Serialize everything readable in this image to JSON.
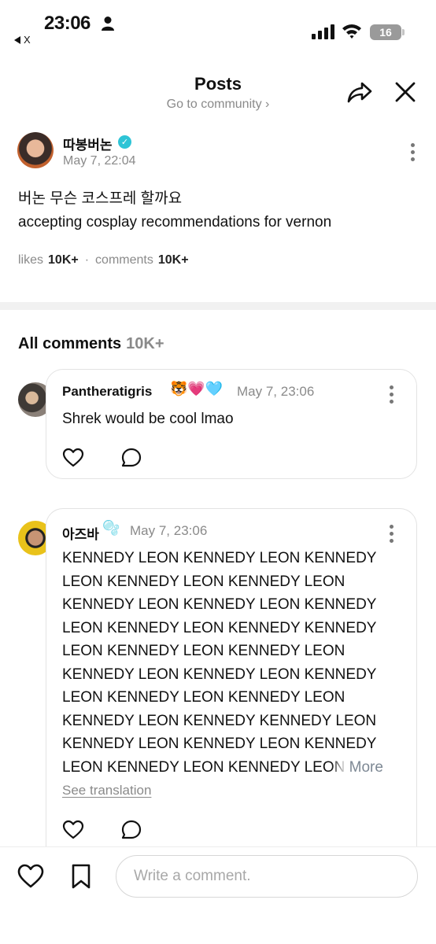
{
  "status_bar": {
    "time": "23:06",
    "back_app": "X",
    "battery": "16"
  },
  "header": {
    "title": "Posts",
    "subtitle": "Go to community ›"
  },
  "post": {
    "author": "따봉버논",
    "date": "May 7, 22:04",
    "text_line1": "버논 무슨 코스프레 할까요",
    "text_line2": "accepting cosplay recommendations for vernon",
    "likes_label": "likes",
    "likes_count": "10K+",
    "separator": "·",
    "comments_label": "comments",
    "comments_count": "10K+"
  },
  "comments_section": {
    "title": "All comments",
    "count": "10K+"
  },
  "comments": [
    {
      "author": "Pantheratigris",
      "emoji": "🐯💗🩵",
      "date": "May 7, 23:06",
      "text": "Shrek would be cool lmao"
    },
    {
      "author": "아즈바",
      "emoji": "🫧",
      "date": "May 7, 23:06",
      "lines": [
        "KENNEDY LEON KENNEDY LEON KENNEDY",
        "LEON KENNEDY LEON KENNEDY LEON",
        "KENNEDY LEON KENNEDY LEON KENNEDY",
        "LEON KENNEDY LEON KENNEDY KENNEDY",
        "LEON KENNEDY LEON KENNEDY LEON",
        "KENNEDY LEON KENNEDY LEON KENNEDY",
        "LEON KENNEDY LEON KENNEDY LEON",
        "KENNEDY LEON KENNEDY KENNEDY LEON",
        "KENNEDY LEON KENNEDY LEON KENNEDY"
      ],
      "last_line": "LEON KENNEDY LEON KENNEDY LE",
      "last_line_fade": "ON",
      "more": "More",
      "see_translation": "See translation"
    }
  ],
  "composer": {
    "placeholder": "Write a comment."
  },
  "icons": [
    "person-icon",
    "signal-icon",
    "wifi-icon",
    "share-icon",
    "close-icon",
    "verified-icon",
    "more-icon",
    "heart-icon",
    "comment-icon",
    "bookmark-icon"
  ]
}
